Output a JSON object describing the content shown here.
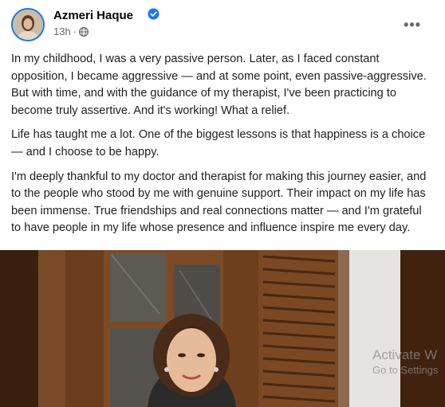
{
  "post": {
    "author": "Azmeri Haque",
    "time": "13h",
    "separator": "·",
    "menu": "•••",
    "paragraphs": [
      "In my childhood, I was a very passive person. Later, as I faced constant opposition, I became aggressive — and at some point, even passive-aggressive. But with time, and with the guidance of my therapist, I've been practicing to become truly assertive. And it's working! What a relief.",
      "Life has taught me a lot. One of the biggest lessons is that happiness is a choice — and I choose to be happy.",
      "I'm deeply thankful to my doctor and therapist for making this journey easier, and to the people who stood by me with genuine support. Their impact on my life has been immense. True friendships and real connections matter — and I'm grateful to have people in my life whose presence and influence inspire me every day."
    ]
  },
  "overlay": {
    "activate_title": "Activate W",
    "activate_sub": "Go to Settings"
  },
  "colors": {
    "accent": "#1877f2",
    "secondary_text": "#65676b"
  },
  "icons": {
    "verified": "verified-badge-icon",
    "audience": "globe-icon",
    "menu": "more-options-icon"
  }
}
